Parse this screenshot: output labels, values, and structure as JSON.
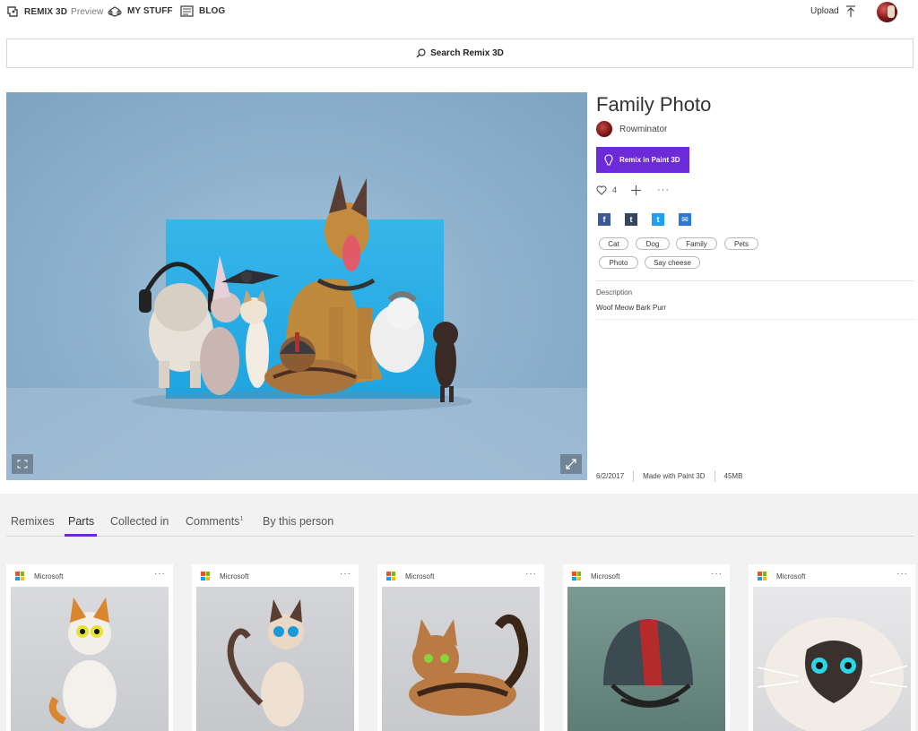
{
  "nav": {
    "brand": "REMIX 3D",
    "brand_sub": "Preview",
    "my_stuff": "MY STUFF",
    "blog": "BLOG",
    "upload": "Upload"
  },
  "search": {
    "label": "Search Remix 3D"
  },
  "model": {
    "title": "Family Photo",
    "author": "Rowminator",
    "remix_button": "Remix in Paint 3D",
    "likes": "4",
    "more": "···",
    "tags": [
      "Cat",
      "Dog",
      "Family",
      "Pets",
      "Photo",
      "Say cheese"
    ],
    "description_label": "Description",
    "description": "Woof Meow Bark Purr",
    "date": "6/2/2017",
    "made_with": "Made with Paint 3D",
    "size": "45MB"
  },
  "social": {
    "facebook": "f",
    "tumblr": "t",
    "twitter": "t",
    "email": "✉"
  },
  "tabs": {
    "remixes": "Remixes",
    "parts": "Parts",
    "collected_in": "Collected in",
    "comments": "Comments",
    "comments_count": "1",
    "by_this_person": "By this person"
  },
  "cards": [
    {
      "publisher": "Microsoft",
      "more": "···"
    },
    {
      "publisher": "Microsoft",
      "more": "···"
    },
    {
      "publisher": "Microsoft",
      "more": "···"
    },
    {
      "publisher": "Microsoft",
      "more": "···"
    },
    {
      "publisher": "Microsoft",
      "more": "···"
    }
  ],
  "colors": {
    "accent": "#6b2bd9"
  },
  "icons": [
    "remix3d-logo-icon",
    "my-stuff-icon",
    "blog-icon",
    "upload-icon",
    "search-icon",
    "paint3d-icon",
    "heart-icon",
    "plus-icon",
    "fit-view-icon",
    "expand-icon",
    "microsoft-logo-icon"
  ]
}
